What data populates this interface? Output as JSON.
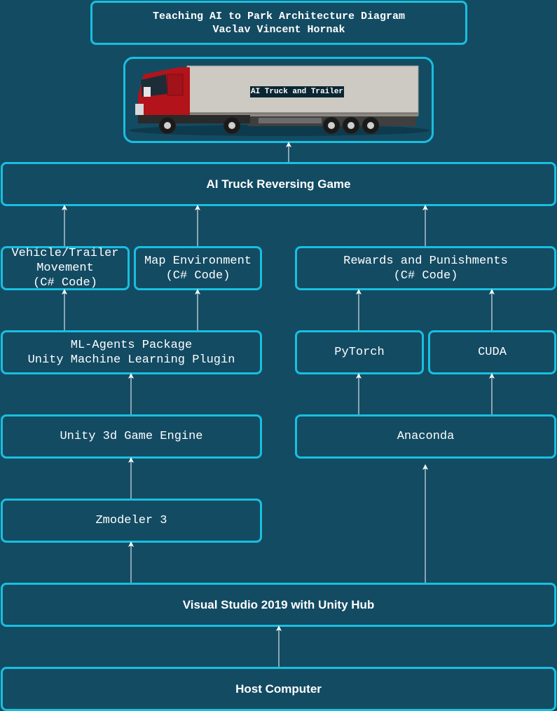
{
  "header": {
    "title_line1": "Teaching AI to Park Architecture Diagram",
    "title_line2": "Vaclav Vincent Hornak"
  },
  "truck": {
    "label": "AI Truck and Trailer",
    "image": "truck-and-trailer-illustration"
  },
  "nodes": {
    "game": "AI Truck Reversing Game",
    "vehicle": "Vehicle/Trailer\nMovement\n(C# Code)",
    "map": "Map Environment\n(C# Code)",
    "rewards": "Rewards and Punishments\n(C# Code)",
    "mlagents": "ML-Agents Package\nUnity Machine Learning Plugin",
    "pytorch": "PyTorch",
    "cuda": "CUDA",
    "unity": "Unity 3d Game Engine",
    "anaconda": "Anaconda",
    "zmodeler": "Zmodeler 3",
    "vs": "Visual Studio 2019 with Unity Hub",
    "host": "Host Computer"
  },
  "colors": {
    "background": "#134b63",
    "border": "#19bfdf",
    "text": "#ffffff",
    "truck_cab": "#b3131a",
    "trailer": "#cdcac3"
  }
}
